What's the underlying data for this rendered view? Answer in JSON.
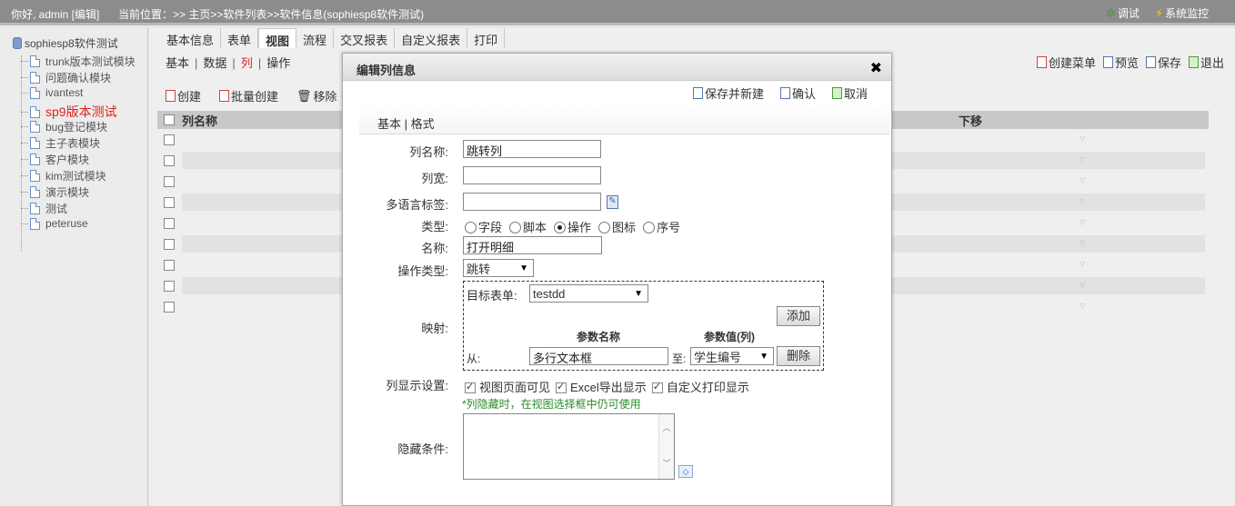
{
  "topbar": {
    "greeting": "你好, admin [编辑]",
    "location": "当前位置：>> 主页>>软件列表>>软件信息(sophiesp8软件测试)",
    "debug": "调试",
    "monitor": "系统监控"
  },
  "tree": {
    "root": "sophiesp8软件测试",
    "items": [
      "trunk版本测试模块",
      "问题确认模块",
      "ivantest",
      "sp9版本测试",
      "bug登记模块",
      "主子表模块",
      "客户模块",
      "kim测试模块",
      "演示模块",
      "测试",
      "peteruse"
    ],
    "active_index": 3
  },
  "tabs": [
    "基本信息",
    "表单",
    "视图",
    "流程",
    "交叉报表",
    "自定义报表",
    "打印"
  ],
  "subnav": [
    "基本",
    "数据",
    "列",
    "操作"
  ],
  "toolbar_right": [
    "创建菜单",
    "预览",
    "保存",
    "退出"
  ],
  "toolbar_left": [
    "创建",
    "批量创建",
    "移除"
  ],
  "grid": {
    "col_name": "列名称",
    "col_down": "下移",
    "row_count": 9
  },
  "dialog": {
    "title": "编辑列信息",
    "actions": [
      "保存并新建",
      "确认",
      "取消"
    ],
    "tabs": "基本 | 格式",
    "fields": {
      "col_name_label": "列名称:",
      "col_name_value": "跳转列",
      "col_width_label": "列宽:",
      "col_width_value": "",
      "i18n_label": "多语言标签:",
      "i18n_value": "",
      "type_label": "类型:",
      "type_options": [
        "字段",
        "脚本",
        "操作",
        "图标",
        "序号"
      ],
      "type_selected": "操作",
      "name_label": "名称:",
      "name_value": "打开明细",
      "op_type_label": "操作类型:",
      "op_type_value": "跳转",
      "mapping_label": "映射:",
      "target_form_label": "目标表单:",
      "target_form_value": "testdd",
      "add_button": "添加",
      "param_name_header": "参数名称",
      "param_value_header": "参数值(列)",
      "from_label": "从:",
      "from_value": "多行文本框",
      "to_label": "至:",
      "to_value": "学生编号",
      "delete_button": "删除",
      "display_label": "列显示设置:",
      "display_options": [
        "视图页面可见",
        "Excel导出显示",
        "自定义打印显示"
      ],
      "hint": "*列隐藏时，在视图选择框中仍可使用",
      "hide_cond_label": "隐藏条件:"
    }
  }
}
